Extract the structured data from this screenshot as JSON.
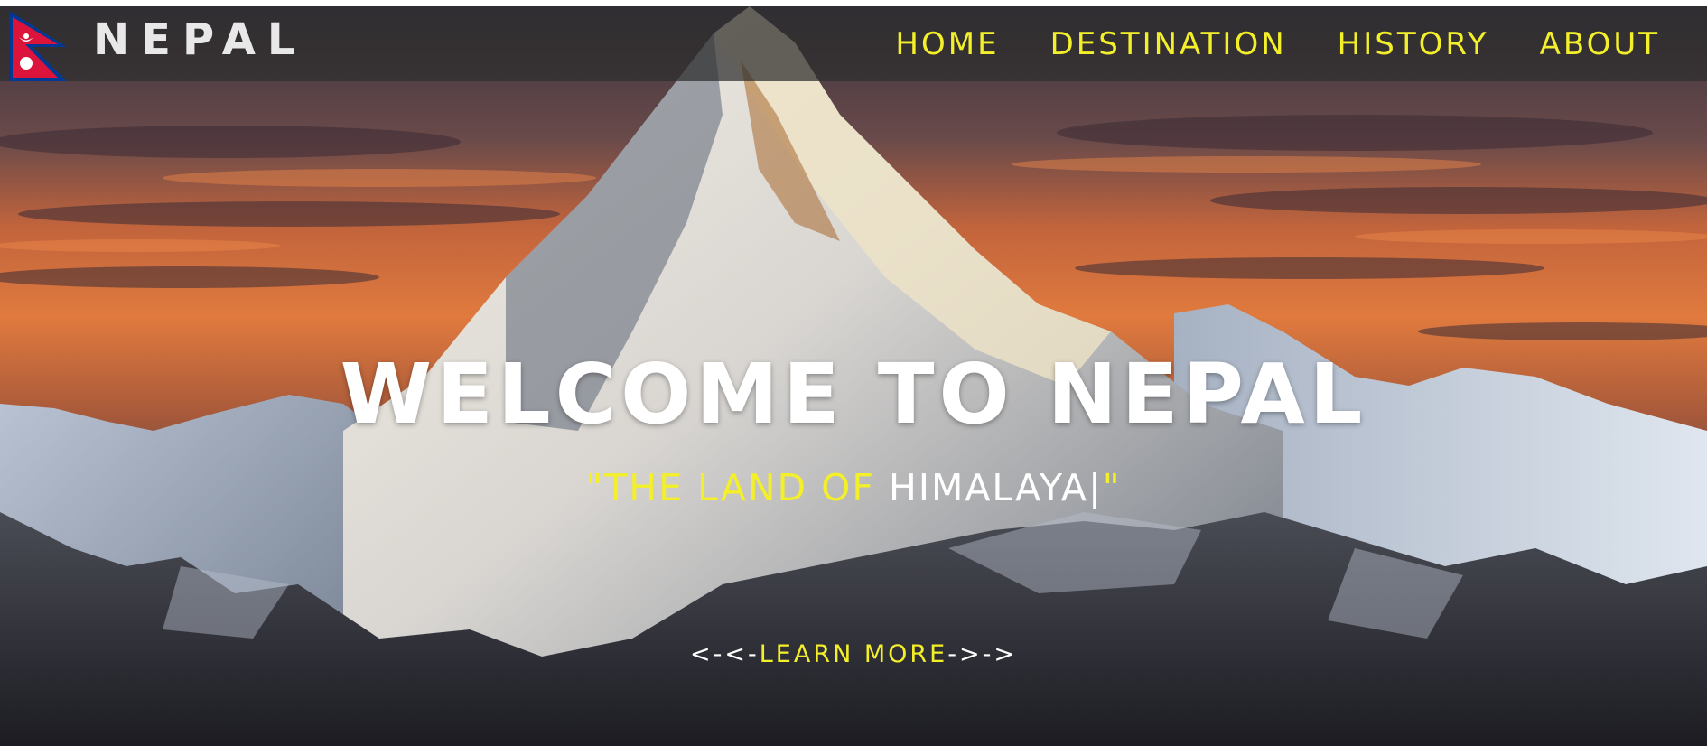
{
  "site": {
    "brand": "NEPAL"
  },
  "nav": {
    "items": [
      {
        "label": "HOME"
      },
      {
        "label": "DESTINATION"
      },
      {
        "label": "HISTORY"
      },
      {
        "label": "ABOUT"
      }
    ]
  },
  "hero": {
    "title": "WELCOME TO NEPAL",
    "tagline": {
      "open_quote": "\"",
      "lead": "THE LAND OF ",
      "word": "HIMALAYA",
      "cursor": "|",
      "close_quote": "\""
    },
    "cta": {
      "prefix": "<-<-",
      "label": "LEARN MORE",
      "suffix": "->->"
    }
  },
  "icons": {
    "logo": "nepal-flag-icon"
  },
  "colors": {
    "accent_yellow": "#f3ef2a",
    "title_white": "#ffffff",
    "navbar_bg": "rgba(45,45,45,0.72)",
    "flag_red": "#dc143c",
    "flag_blue": "#003893"
  }
}
